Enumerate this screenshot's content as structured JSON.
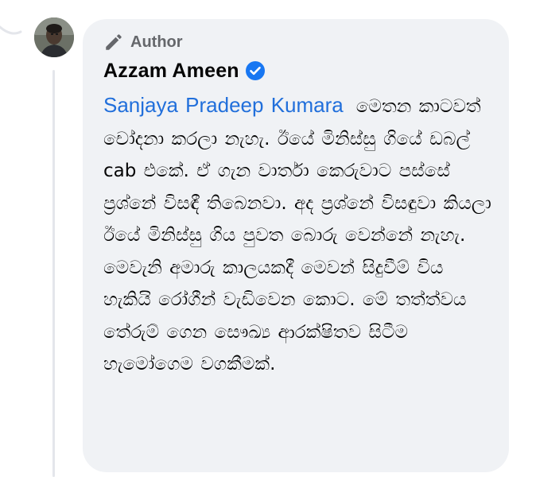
{
  "comment": {
    "badge_label": "Author",
    "author_name": "Azzam Ameen",
    "mention": "Sanjaya Pradeep Kumara",
    "text": "මෙතන කාටවත් චෝදනා කරලා නැහැ. ඊයේ මිනිස්සු ගියේ ඩබල් cab එකේ. ඒ ගැන වාර්තා කෙරුවාට පස්සේ ප්‍රශ්නේ විසඳී තිබෙනවා. අද ප්‍රශ්නේ විසඳුවා කියලා ඊයේ මිනිස්සු ගිය පුවත බොරු වෙන්නේ නැහැ. මෙවැනි අමාරු කාලයකදී මෙවන් සිදුවීම් විය හැකියි රෝගීන් වැඩිවෙන කොට. මේ තත්ත්වය තේරුම් ගෙන සෞඛ්‍ය ආරක්ෂිතව සිටීම හැමෝගෙම වගකීමක්."
  },
  "colors": {
    "bubble_bg": "#f0f2f5",
    "mention": "#216fdb",
    "verified": "#1877f2",
    "badge_text": "#65676b",
    "thread_line": "#e4e6eb"
  },
  "icons": {
    "badge": "pencil-icon",
    "verified": "verified-checkmark-icon",
    "avatar": "user-avatar"
  }
}
